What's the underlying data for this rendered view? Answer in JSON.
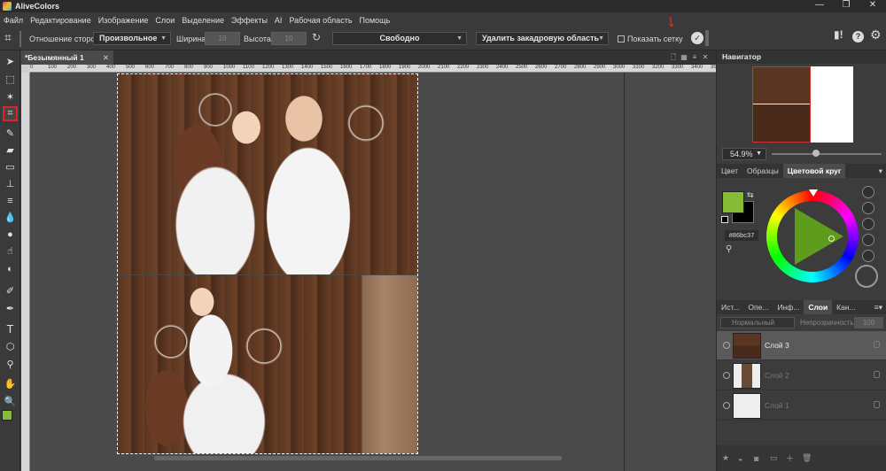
{
  "app": {
    "title": "AliveColors",
    "window_buttons": [
      "—",
      "❐",
      "✕"
    ]
  },
  "menu": [
    "Файл",
    "Редактирование",
    "Изображение",
    "Слои",
    "Выделение",
    "Эффекты",
    "AI",
    "Рабочая область",
    "Помощь"
  ],
  "options": {
    "aspect_label": "Отношение сторон",
    "aspect_value": "Произвольное",
    "width_label": "Ширина",
    "width_value": "10",
    "height_label": "Высота",
    "height_value": "10",
    "mode_value": "Свободно",
    "delete_value": "Удалить закадровую область",
    "grid_label": "Показать сетку"
  },
  "document": {
    "tab_title": "*Безымянный 1",
    "ruler_ticks": [
      "0",
      "100",
      "200",
      "300",
      "400",
      "500",
      "600",
      "700",
      "800",
      "900",
      "1000",
      "1100",
      "1200",
      "1300",
      "1400",
      "1500",
      "1600",
      "1700",
      "1800",
      "1900",
      "2000",
      "2100",
      "2200",
      "2300",
      "2400",
      "2500",
      "2600",
      "2700",
      "2800",
      "2900",
      "3000",
      "3100",
      "3200",
      "3300",
      "3400",
      "3500"
    ]
  },
  "navigator": {
    "title": "Навигатор",
    "zoom": "54.9%"
  },
  "color_panel": {
    "tabs": [
      "Цвет",
      "Образцы",
      "Цветовой круг"
    ],
    "active_tab": "Цветовой круг",
    "hex": "#86bc37",
    "fg_color": "#86bc37",
    "bg_color": "#000000"
  },
  "layers_panel": {
    "tabs": [
      "Ист...",
      "Опе...",
      "Инф...",
      "Слои",
      "Кан..."
    ],
    "active_tab": "Слои",
    "blend_mode": "Нормальный",
    "opacity_label": "Непрозрачность",
    "opacity_value": "100",
    "layers": [
      {
        "name": "Слой 3",
        "selected": true
      },
      {
        "name": "Слой 2",
        "selected": false
      },
      {
        "name": "Слой 1",
        "selected": false
      }
    ]
  }
}
